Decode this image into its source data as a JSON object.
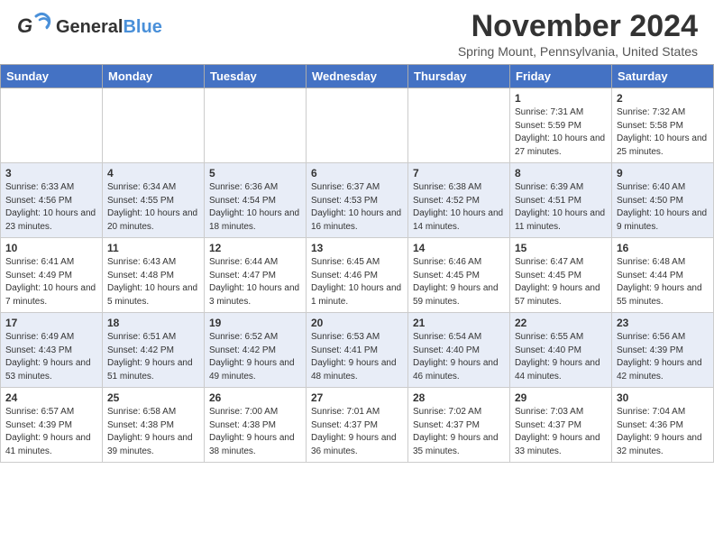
{
  "header": {
    "logo_general": "General",
    "logo_blue": "Blue",
    "main_title": "November 2024",
    "subtitle": "Spring Mount, Pennsylvania, United States"
  },
  "calendar": {
    "days_of_week": [
      "Sunday",
      "Monday",
      "Tuesday",
      "Wednesday",
      "Thursday",
      "Friday",
      "Saturday"
    ],
    "weeks": [
      [
        {
          "day": "",
          "info": ""
        },
        {
          "day": "",
          "info": ""
        },
        {
          "day": "",
          "info": ""
        },
        {
          "day": "",
          "info": ""
        },
        {
          "day": "",
          "info": ""
        },
        {
          "day": "1",
          "info": "Sunrise: 7:31 AM\nSunset: 5:59 PM\nDaylight: 10 hours\nand 27 minutes."
        },
        {
          "day": "2",
          "info": "Sunrise: 7:32 AM\nSunset: 5:58 PM\nDaylight: 10 hours\nand 25 minutes."
        }
      ],
      [
        {
          "day": "3",
          "info": "Sunrise: 6:33 AM\nSunset: 4:56 PM\nDaylight: 10 hours\nand 23 minutes."
        },
        {
          "day": "4",
          "info": "Sunrise: 6:34 AM\nSunset: 4:55 PM\nDaylight: 10 hours\nand 20 minutes."
        },
        {
          "day": "5",
          "info": "Sunrise: 6:36 AM\nSunset: 4:54 PM\nDaylight: 10 hours\nand 18 minutes."
        },
        {
          "day": "6",
          "info": "Sunrise: 6:37 AM\nSunset: 4:53 PM\nDaylight: 10 hours\nand 16 minutes."
        },
        {
          "day": "7",
          "info": "Sunrise: 6:38 AM\nSunset: 4:52 PM\nDaylight: 10 hours\nand 14 minutes."
        },
        {
          "day": "8",
          "info": "Sunrise: 6:39 AM\nSunset: 4:51 PM\nDaylight: 10 hours\nand 11 minutes."
        },
        {
          "day": "9",
          "info": "Sunrise: 6:40 AM\nSunset: 4:50 PM\nDaylight: 10 hours\nand 9 minutes."
        }
      ],
      [
        {
          "day": "10",
          "info": "Sunrise: 6:41 AM\nSunset: 4:49 PM\nDaylight: 10 hours\nand 7 minutes."
        },
        {
          "day": "11",
          "info": "Sunrise: 6:43 AM\nSunset: 4:48 PM\nDaylight: 10 hours\nand 5 minutes."
        },
        {
          "day": "12",
          "info": "Sunrise: 6:44 AM\nSunset: 4:47 PM\nDaylight: 10 hours\nand 3 minutes."
        },
        {
          "day": "13",
          "info": "Sunrise: 6:45 AM\nSunset: 4:46 PM\nDaylight: 10 hours\nand 1 minute."
        },
        {
          "day": "14",
          "info": "Sunrise: 6:46 AM\nSunset: 4:45 PM\nDaylight: 9 hours\nand 59 minutes."
        },
        {
          "day": "15",
          "info": "Sunrise: 6:47 AM\nSunset: 4:45 PM\nDaylight: 9 hours\nand 57 minutes."
        },
        {
          "day": "16",
          "info": "Sunrise: 6:48 AM\nSunset: 4:44 PM\nDaylight: 9 hours\nand 55 minutes."
        }
      ],
      [
        {
          "day": "17",
          "info": "Sunrise: 6:49 AM\nSunset: 4:43 PM\nDaylight: 9 hours\nand 53 minutes."
        },
        {
          "day": "18",
          "info": "Sunrise: 6:51 AM\nSunset: 4:42 PM\nDaylight: 9 hours\nand 51 minutes."
        },
        {
          "day": "19",
          "info": "Sunrise: 6:52 AM\nSunset: 4:42 PM\nDaylight: 9 hours\nand 49 minutes."
        },
        {
          "day": "20",
          "info": "Sunrise: 6:53 AM\nSunset: 4:41 PM\nDaylight: 9 hours\nand 48 minutes."
        },
        {
          "day": "21",
          "info": "Sunrise: 6:54 AM\nSunset: 4:40 PM\nDaylight: 9 hours\nand 46 minutes."
        },
        {
          "day": "22",
          "info": "Sunrise: 6:55 AM\nSunset: 4:40 PM\nDaylight: 9 hours\nand 44 minutes."
        },
        {
          "day": "23",
          "info": "Sunrise: 6:56 AM\nSunset: 4:39 PM\nDaylight: 9 hours\nand 42 minutes."
        }
      ],
      [
        {
          "day": "24",
          "info": "Sunrise: 6:57 AM\nSunset: 4:39 PM\nDaylight: 9 hours\nand 41 minutes."
        },
        {
          "day": "25",
          "info": "Sunrise: 6:58 AM\nSunset: 4:38 PM\nDaylight: 9 hours\nand 39 minutes."
        },
        {
          "day": "26",
          "info": "Sunrise: 7:00 AM\nSunset: 4:38 PM\nDaylight: 9 hours\nand 38 minutes."
        },
        {
          "day": "27",
          "info": "Sunrise: 7:01 AM\nSunset: 4:37 PM\nDaylight: 9 hours\nand 36 minutes."
        },
        {
          "day": "28",
          "info": "Sunrise: 7:02 AM\nSunset: 4:37 PM\nDaylight: 9 hours\nand 35 minutes."
        },
        {
          "day": "29",
          "info": "Sunrise: 7:03 AM\nSunset: 4:37 PM\nDaylight: 9 hours\nand 33 minutes."
        },
        {
          "day": "30",
          "info": "Sunrise: 7:04 AM\nSunset: 4:36 PM\nDaylight: 9 hours\nand 32 minutes."
        }
      ]
    ]
  }
}
